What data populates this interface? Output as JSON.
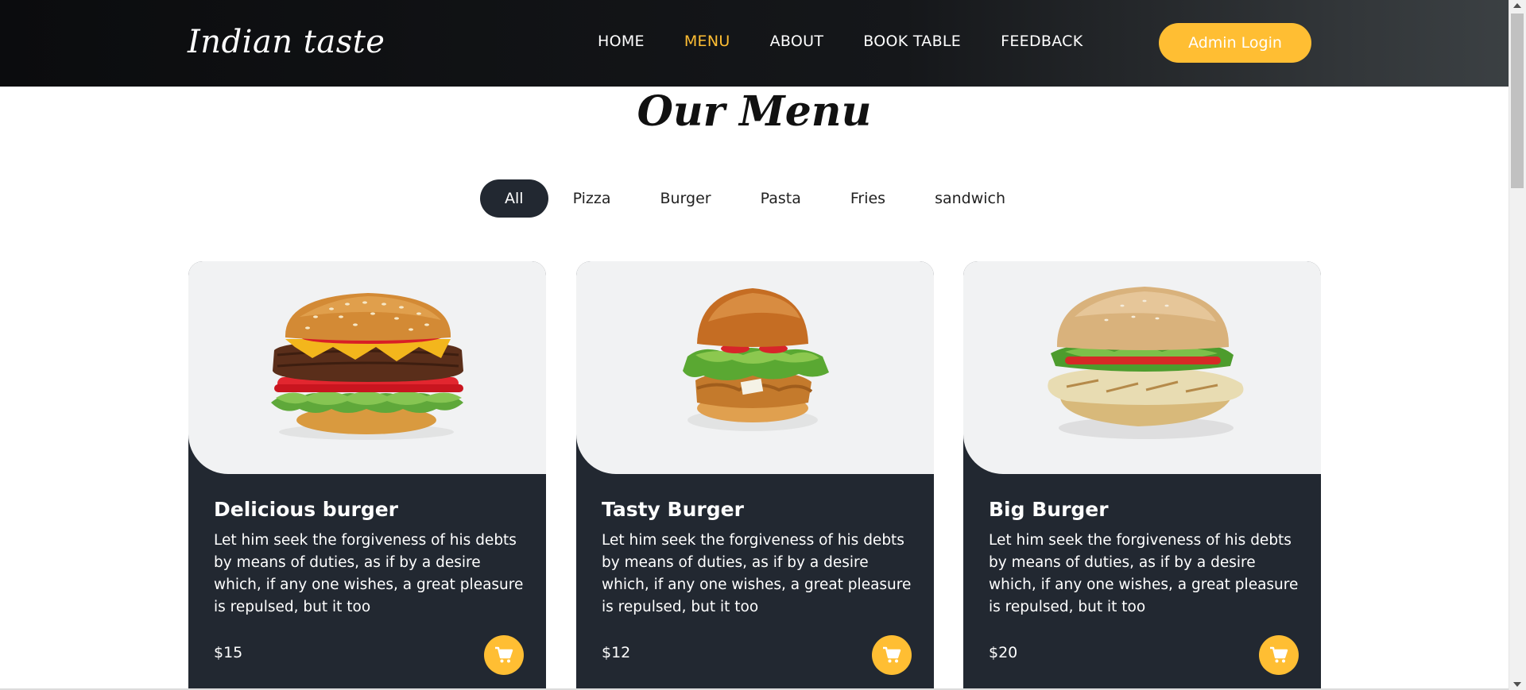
{
  "header": {
    "brand": "Indian taste",
    "nav": [
      {
        "label": "HOME",
        "active": false
      },
      {
        "label": "MENU",
        "active": true
      },
      {
        "label": "ABOUT",
        "active": false
      },
      {
        "label": "BOOK TABLE",
        "active": false
      },
      {
        "label": "FEEDBACK",
        "active": false
      }
    ],
    "admin_button": "Admin Login"
  },
  "section": {
    "title": "Our Menu",
    "filters": [
      {
        "label": "All",
        "active": true
      },
      {
        "label": "Pizza",
        "active": false
      },
      {
        "label": "Burger",
        "active": false
      },
      {
        "label": "Pasta",
        "active": false
      },
      {
        "label": "Fries",
        "active": false
      },
      {
        "label": "sandwich",
        "active": false
      }
    ]
  },
  "items": [
    {
      "name": "Delicious burger",
      "description": "Let him seek the forgiveness of his debts by means of duties, as if by a desire which, if any one wishes, a great pleasure is repulsed, but it too",
      "price": "$15",
      "image_icon": "cheeseburger-image"
    },
    {
      "name": "Tasty Burger",
      "description": "Let him seek the forgiveness of his debts by means of duties, as if by a desire which, if any one wishes, a great pleasure is repulsed, but it too",
      "price": "$12",
      "image_icon": "chicken-burger-image"
    },
    {
      "name": "Big Burger",
      "description": "Let him seek the forgiveness of his debts by means of duties, as if by a desire which, if any one wishes, a great pleasure is repulsed, but it too",
      "price": "$20",
      "image_icon": "grilled-chicken-sandwich-image"
    }
  ],
  "colors": {
    "accent": "#ffbe33",
    "dark": "#222831",
    "image_bg": "#f1f2f3"
  }
}
